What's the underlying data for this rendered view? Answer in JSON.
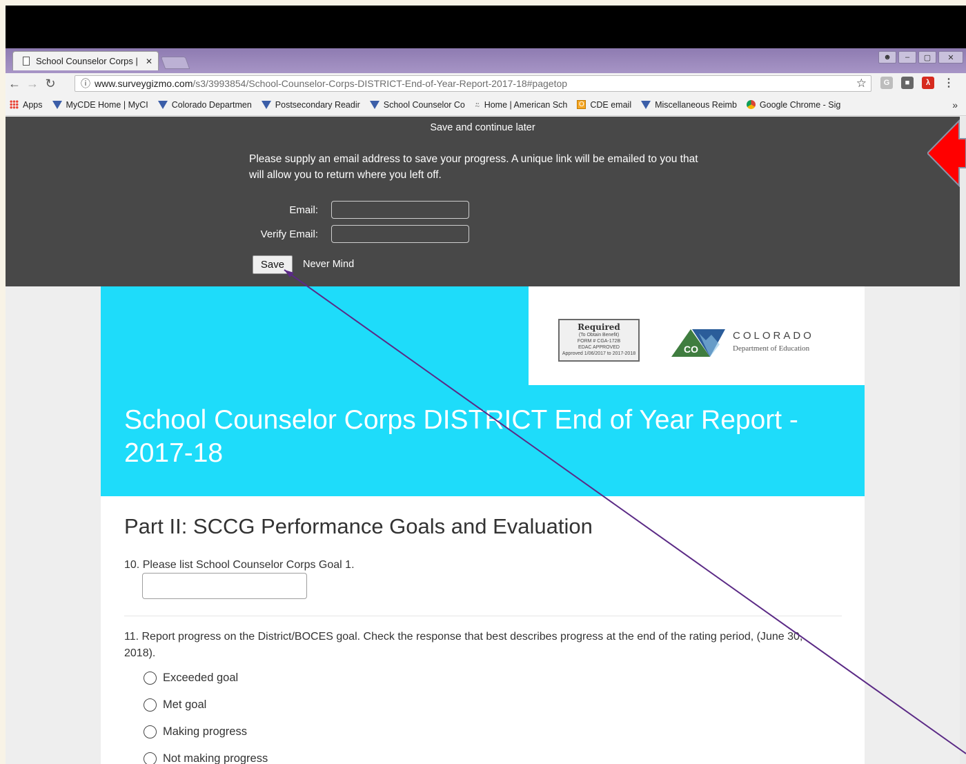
{
  "browser": {
    "tab_title": "School Counselor Corps |",
    "tab_close": "✕",
    "url_domain": "www.surveygizmo.com",
    "url_path": "/s3/3993854/School-Counselor-Corps-DISTRICT-End-of-Year-Report-2017-18#pagetop",
    "window_controls": [
      "–",
      "▢",
      "✕"
    ],
    "bookmarks": [
      {
        "label": "Apps",
        "icon": "apps-grid-icon"
      },
      {
        "label": "MyCDE Home | MyCI",
        "icon": "cde-triangle-icon"
      },
      {
        "label": "Colorado Departmen",
        "icon": "cde-triangle-icon"
      },
      {
        "label": "Postsecondary Readir",
        "icon": "cde-triangle-icon"
      },
      {
        "label": "School Counselor Co",
        "icon": "cde-triangle-icon"
      },
      {
        "label": "Home | American Sch",
        "icon": "tree-icon"
      },
      {
        "label": "CDE email",
        "icon": "outlook-icon"
      },
      {
        "label": "Miscellaneous Reimb",
        "icon": "cde-triangle-icon"
      },
      {
        "label": "Google Chrome - Sig",
        "icon": "chrome-icon"
      }
    ],
    "bookmarks_more": "»"
  },
  "save_panel": {
    "title": "Save and continue later",
    "message": "Please supply an email address to save your progress. A unique link will be emailed to you that will allow you to return where you left off.",
    "email_label": "Email:",
    "verify_label": "Verify Email:",
    "save_button": "Save",
    "never_mind": "Never Mind"
  },
  "survey": {
    "stamp_title": "Required",
    "stamp_lines": [
      "(To Obtain Benefit)",
      "FORM # CGA-172B",
      "EDAC APPROVED",
      "Approved 1/06/2017 to 2017-2018"
    ],
    "logo_name": "COLORADO",
    "logo_dept": "Department of Education",
    "logo_badge": "CO",
    "title": "School Counselor Corps DISTRICT End of Year Report - 2017-18",
    "part_title": "Part II: SCCG Performance Goals and Evaluation",
    "q10": "10. Please list School Counselor Corps Goal 1.",
    "q11": "11. Report progress on the District/BOCES goal.  Check the response that best describes progress at the end of the rating period, (June 30, 2018).",
    "options": [
      "Exceeded goal",
      "Met goal",
      "Making progress",
      "Not making progress"
    ]
  },
  "colors": {
    "banner": "#1edcfa",
    "panel": "#484848",
    "callout_arrow": "#ff0000",
    "annotation_line": "#5b2a86"
  }
}
